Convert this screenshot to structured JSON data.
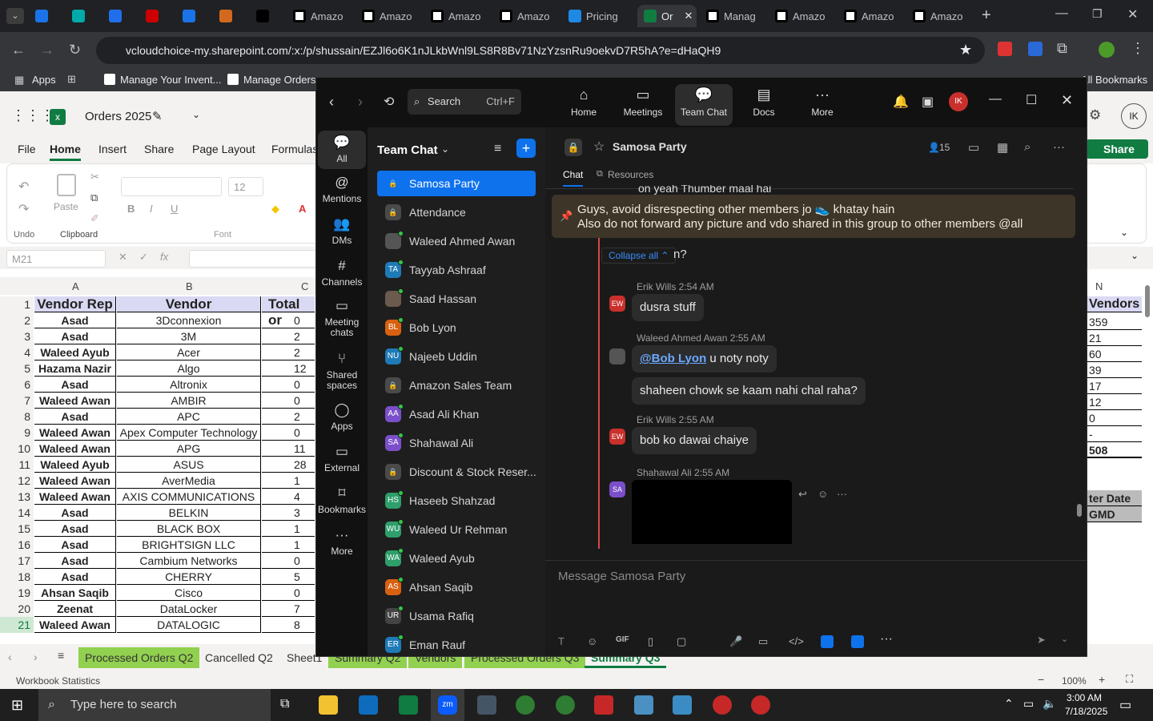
{
  "browser": {
    "tabs": [
      {
        "label": "",
        "color": "#1a73e8"
      },
      {
        "label": "",
        "color": "#0aa"
      },
      {
        "label": "",
        "color": "#1f6feb"
      },
      {
        "label": "",
        "color": "#c00"
      },
      {
        "label": "",
        "color": "#1a73e8"
      },
      {
        "label": "",
        "color": "#d2691e"
      },
      {
        "label": "",
        "color": "#000"
      },
      {
        "label": "",
        "color": "#000"
      },
      {
        "label": "Amazo",
        "color": "#000"
      },
      {
        "label": "Amazo",
        "color": "#000"
      },
      {
        "label": "Amazo",
        "color": "#000"
      },
      {
        "label": "Amazo",
        "color": "#000"
      },
      {
        "label": "Pricing",
        "color": "#1e88e5"
      },
      {
        "label": "Or",
        "color": "#107c41"
      },
      {
        "label": "Manag",
        "color": "#000"
      },
      {
        "label": "Amazo",
        "color": "#000"
      },
      {
        "label": "Amazo",
        "color": "#000"
      },
      {
        "label": "Amazo",
        "color": "#000"
      }
    ],
    "url": "vcloudchoice-my.sharepoint.com/:x:/p/shussain/EZJl6o6K1nJLkbWnl9LS8R8Bv71NzYzsnRu9oekvD7R5hA?e=dHaQH9",
    "bookmarks": [
      "Apps",
      "Manage Your Invent...",
      "Manage Orders"
    ],
    "all_bookmarks": "All Bookmarks"
  },
  "excel": {
    "title": "Orders 2025",
    "ribbon_tabs": [
      "File",
      "Home",
      "Insert",
      "Share",
      "Page Layout",
      "Formulas"
    ],
    "share": "Share",
    "avatar": "IK",
    "cellref": "M21",
    "font_size": "12",
    "groups": {
      "undo": "Undo",
      "clipboard": "Clipboard",
      "font": "Font",
      "paste": "Paste"
    },
    "col_headers": {
      "a": "A",
      "b": "B",
      "c": "C",
      "n": "N"
    },
    "header_row": {
      "a": "Vendor Rep",
      "b": "Vendor",
      "c": "Total or"
    },
    "rows": [
      {
        "n": "2",
        "a": "Asad",
        "b": "3Dconnexion",
        "c": "0"
      },
      {
        "n": "3",
        "a": "Asad",
        "b": "3M",
        "c": "2"
      },
      {
        "n": "4",
        "a": "Waleed Ayub",
        "b": "Acer",
        "c": "2"
      },
      {
        "n": "5",
        "a": "Hazama Nazir",
        "b": "Algo",
        "c": "12"
      },
      {
        "n": "6",
        "a": "Asad",
        "b": "Altronix",
        "c": "0"
      },
      {
        "n": "7",
        "a": "Waleed Awan",
        "b": "AMBIR",
        "c": "0"
      },
      {
        "n": "8",
        "a": "Asad",
        "b": "APC",
        "c": "2"
      },
      {
        "n": "9",
        "a": "Waleed Awan",
        "b": "Apex Computer Technology",
        "c": "0"
      },
      {
        "n": "10",
        "a": "Waleed Awan",
        "b": "APG",
        "c": "11"
      },
      {
        "n": "11",
        "a": "Waleed Ayub",
        "b": "ASUS",
        "c": "28"
      },
      {
        "n": "12",
        "a": "Waleed Awan",
        "b": "AverMedia",
        "c": "1"
      },
      {
        "n": "13",
        "a": "Waleed Awan",
        "b": "AXIS COMMUNICATIONS",
        "c": "4"
      },
      {
        "n": "14",
        "a": "Asad",
        "b": "BELKIN",
        "c": "3"
      },
      {
        "n": "15",
        "a": "Asad",
        "b": "BLACK BOX",
        "c": "1"
      },
      {
        "n": "16",
        "a": "Asad",
        "b": "BRIGHTSIGN LLC",
        "c": "1"
      },
      {
        "n": "17",
        "a": "Asad",
        "b": "Cambium Networks",
        "c": "0"
      },
      {
        "n": "18",
        "a": "Asad",
        "b": "CHERRY",
        "c": "5"
      },
      {
        "n": "19",
        "a": "Ahsan Saqib",
        "b": "Cisco",
        "c": "0"
      },
      {
        "n": "20",
        "a": "Zeenat",
        "b": "DataLocker",
        "c": "7"
      },
      {
        "n": "21",
        "a": "Waleed Awan",
        "b": "DATALOGIC",
        "c": "8"
      }
    ],
    "right_col": {
      "header": "Vendors",
      "values": [
        "359",
        "21",
        "60",
        "39",
        "17",
        "12",
        "0",
        "-",
        "508"
      ],
      "extra1": "ter Date",
      "extra2": "GMD"
    },
    "sheets": [
      "Processed Orders Q2",
      "Cancelled Q2",
      "Sheet1",
      "Summary Q2",
      "Vendors",
      "Processed Orders Q3",
      "Summary Q3"
    ],
    "status": "Workbook Statistics",
    "zoom": "100%"
  },
  "zoomapp": {
    "nav": [
      "Home",
      "Meetings",
      "Team Chat",
      "Docs",
      "More"
    ],
    "search": "Search",
    "shortcut": "Ctrl+F",
    "avatar": "IK",
    "rail": [
      "All",
      "Mentions",
      "DMs",
      "Channels",
      "Meeting chats",
      "Shared spaces",
      "Apps",
      "External",
      "Bookmarks",
      "More"
    ],
    "list_title": "Team Chat",
    "contacts": [
      {
        "name": "Samosa Party",
        "ini": "",
        "color": "#4a4a4a",
        "lock": true
      },
      {
        "name": "Attendance",
        "ini": "",
        "color": "#4a4a4a",
        "lock": true
      },
      {
        "name": "Waleed Ahmed Awan",
        "ini": "",
        "color": "#555",
        "lock": false
      },
      {
        "name": "Tayyab Ashraaf",
        "ini": "TA",
        "color": "#1e7bb8",
        "lock": false
      },
      {
        "name": "Saad Hassan",
        "ini": "",
        "color": "#6b5a4e",
        "lock": false
      },
      {
        "name": "Bob Lyon",
        "ini": "BL",
        "color": "#d9600f",
        "lock": false
      },
      {
        "name": "Najeeb Uddin",
        "ini": "NU",
        "color": "#1e7bb8",
        "lock": false
      },
      {
        "name": "Amazon Sales Team",
        "ini": "",
        "color": "#4a4a4a",
        "lock": true
      },
      {
        "name": "Asad Ali Khan",
        "ini": "AA",
        "color": "#7b4fc9",
        "lock": false
      },
      {
        "name": "Shahawal Ali",
        "ini": "SA",
        "color": "#7b4fc9",
        "lock": false
      },
      {
        "name": "Discount & Stock Reser...",
        "ini": "",
        "color": "#4a4a4a",
        "lock": true
      },
      {
        "name": "Haseeb Shahzad",
        "ini": "HS",
        "color": "#2e9e6b",
        "lock": false
      },
      {
        "name": "Waleed Ur Rehman",
        "ini": "WU",
        "color": "#2e9e6b",
        "lock": false
      },
      {
        "name": "Waleed Ayub",
        "ini": "WA",
        "color": "#2e9e6b",
        "lock": false
      },
      {
        "name": "Ahsan Saqib",
        "ini": "AS",
        "color": "#d9600f",
        "lock": false
      },
      {
        "name": "Usama Rafiq",
        "ini": "UR",
        "color": "#444",
        "lock": false
      },
      {
        "name": "Eman Rauf",
        "ini": "ER",
        "color": "#1e7bb8",
        "lock": false
      }
    ],
    "channel": "Samosa Party",
    "members": "15",
    "tabs": [
      "Chat",
      "Resources"
    ],
    "top_cut": "on yeah Thumber maal hai",
    "pinned": [
      "Guys, avoid disrespecting other members jo 👟 khatay hain",
      "Also do not forward any picture and vdo shared in this group to other members @all"
    ],
    "collapse": "Collapse all",
    "partial": "n?",
    "messages": [
      {
        "name": "Erik Wills 2:54 AM",
        "text": "dusra stuff"
      },
      {
        "name": "Waleed Ahmed Awan 2:55 AM",
        "mention": "@Bob Lyon",
        "text": " u noty noty"
      },
      {
        "name": "",
        "text": "shaheen chowk se kaam nahi chal raha?"
      },
      {
        "name": "Erik Wills 2:55 AM",
        "text": "bob ko dawai chaiye"
      },
      {
        "name": "Shahawal Ali 2:55 AM",
        "text": ""
      }
    ],
    "placeholder": "Message Samosa Party"
  },
  "taskbar": {
    "search": "Type here to search",
    "time": "3:00 AM",
    "date": "7/18/2025"
  }
}
